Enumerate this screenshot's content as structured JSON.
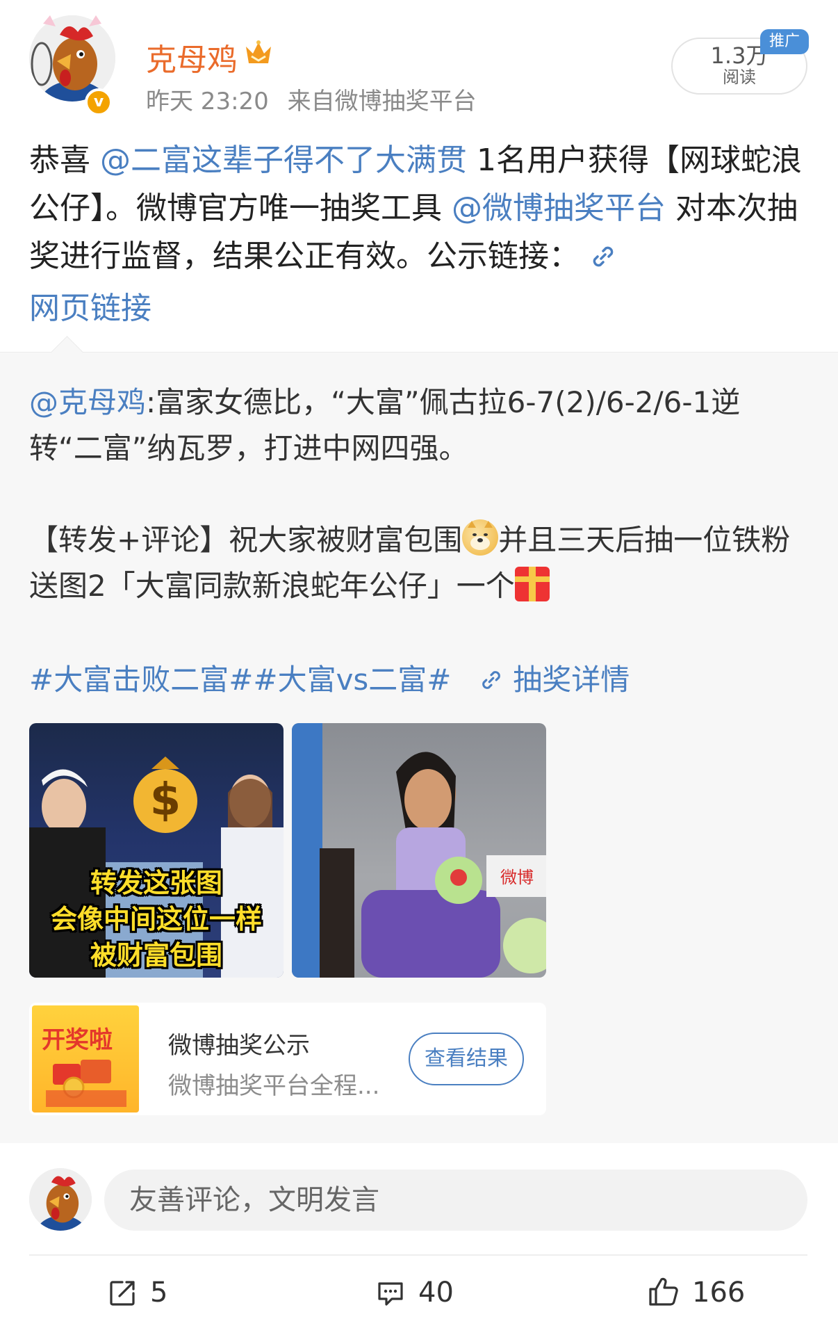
{
  "header": {
    "username": "克母鸡",
    "timestamp": "昨天 23:20",
    "source": "来自微博抽奖平台",
    "views_count": "1.3万",
    "views_label": "阅读",
    "promo_badge": "推广",
    "verified_badge": "v"
  },
  "post": {
    "prefix": "恭喜 ",
    "mention_winner": "@二富这辈子得不了大满贯",
    "text1": " 1名用户获得【网球蛇浪公仔】。微博官方唯一抽奖工具 ",
    "mention_platform": "@微博抽奖平台",
    "text2": " 对本次抽奖进行监督，结果公正有效。公示链接：",
    "link_label": "网页链接"
  },
  "repost": {
    "author": "@克母鸡",
    "line1": ":富家女德比，“大富”佩古拉6-7(2)/6-2/6-1逆转“二富”纳瓦罗，打进中网四强。",
    "line2a": "【转发+评论】祝大家被财富包围",
    "line2b": "并且三天后抽一位铁粉送图2「大富同款新浪蛇年公仔」一个",
    "tags": "#大富击败二富##大富vs二富#",
    "lottery_detail": "抽奖详情",
    "image1_caption_lines": [
      "转发这张图",
      "会像中间这位一样",
      "被财富包围"
    ]
  },
  "lottery_card": {
    "thumb_text": "开奖啦",
    "title": "微博抽奖公示",
    "description": "微博抽奖平台全程...",
    "button": "查看结果"
  },
  "comment_input": {
    "placeholder": "友善评论，文明发言"
  },
  "actions": {
    "repost_count": "5",
    "comment_count": "40",
    "like_count": "166"
  },
  "colors": {
    "link": "#4a7fc1",
    "username": "#ea6b2b",
    "promo_badge": "#4a8fd8"
  },
  "icons": [
    "verified-v-icon",
    "crown-badge-icon",
    "link-icon",
    "doge-emoji-icon",
    "gift-emoji-icon",
    "repost-icon",
    "comment-icon",
    "like-icon"
  ]
}
